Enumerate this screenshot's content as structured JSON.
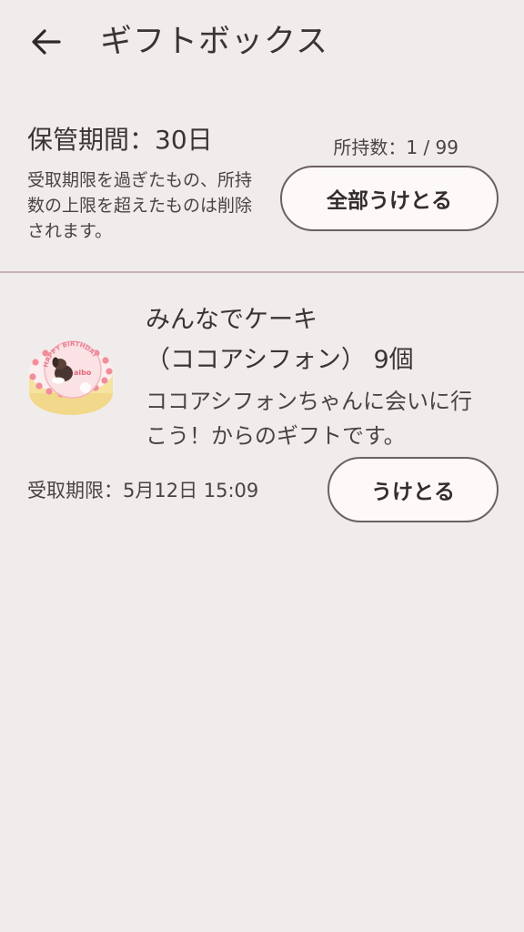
{
  "header": {
    "back_icon": "arrow-left-icon",
    "title": "ギフトボックス"
  },
  "summary": {
    "storage_period": "保管期間：30日",
    "note": "受取期限を過ぎたもの、所持数の上限を超えたものは削除されます。",
    "count": "所持数：1 / 99",
    "receive_all_label": "全部うけとる"
  },
  "gifts": [
    {
      "image_icon": "birthday-cake-icon",
      "image_text": "HAPPY BIRTHDAY",
      "image_logo_text": "aibo",
      "name_line1": "みんなでケーキ",
      "name_line2": "（ココアシフォン） 9個",
      "from": "ココアシフォンちゃんに会いに行こう！からのギフトです。",
      "deadline": "受取期限：5月12日 15:09",
      "receive_label": "うけとる"
    }
  ],
  "colors": {
    "background": "#f1ecec",
    "divider": "#c7b3b5",
    "button_bg": "#fcf9f8",
    "button_border": "#6a6260"
  }
}
